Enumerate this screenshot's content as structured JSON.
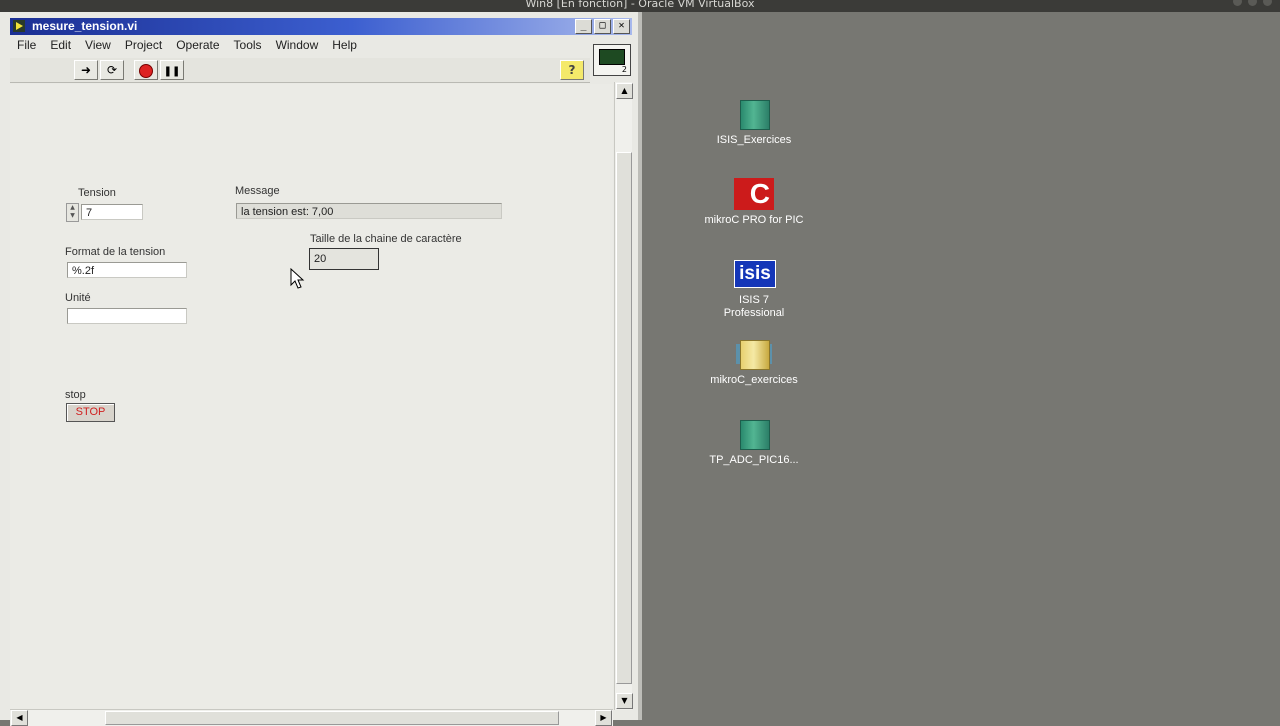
{
  "host": {
    "title": "Win8 [En fonction] - Oracle VM VirtualBox"
  },
  "window": {
    "title": "mesure_tension.vi",
    "controls": {
      "minimize": "_",
      "maximize": "□",
      "close": "✕"
    }
  },
  "menu": [
    "File",
    "Edit",
    "View",
    "Project",
    "Operate",
    "Tools",
    "Window",
    "Help"
  ],
  "toolbar": {
    "help": "?",
    "connector_number": "2"
  },
  "controls": {
    "tension_label": "Tension",
    "tension_value": "7",
    "message_label": "Message",
    "message_value": "la tension est: 7,00",
    "taille_label": "Taille de la chaine de caractère",
    "taille_value": "20",
    "format_label": "Format de la tension",
    "format_value": "%.2f",
    "unite_label": "Unité",
    "unite_value": "",
    "stop_label": "stop",
    "stop_button": "STOP"
  },
  "desktop": [
    {
      "label": "ISIS_Exercices",
      "icon": "book-icon"
    },
    {
      "label": "mikroC PRO for PIC",
      "icon": "mikroc-icon"
    },
    {
      "label": "ISIS 7 Professional",
      "icon": "isis-icon"
    },
    {
      "label": "mikroC_exercices",
      "icon": "zipbook-icon"
    },
    {
      "label": "TP_ADC_PIC16...",
      "icon": "book-icon"
    }
  ]
}
